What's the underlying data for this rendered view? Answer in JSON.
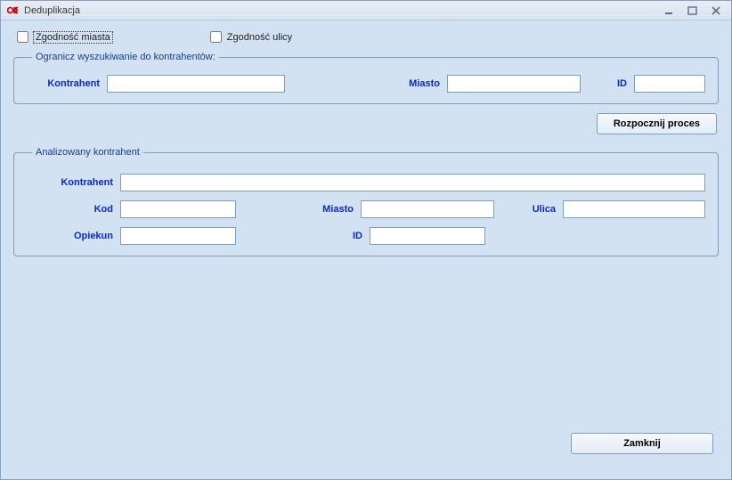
{
  "window": {
    "title": "Deduplikacja"
  },
  "checkboxes": {
    "city_match_label": "Zgodność miasta",
    "street_match_label": "Zgodność ulicy"
  },
  "search_limit": {
    "legend": "Ogranicz wyszukiwanie do kontrahentów:",
    "kontrahent_label": "Kontrahent",
    "kontrahent_value": "",
    "miasto_label": "Miasto",
    "miasto_value": "",
    "id_label": "ID",
    "id_value": ""
  },
  "buttons": {
    "start_process": "Rozpocznij proces",
    "close": "Zamknij"
  },
  "analyzed": {
    "legend": "Analizowany kontrahent",
    "kontrahent_label": "Kontrahent",
    "kontrahent_value": "",
    "kod_label": "Kod",
    "kod_value": "",
    "miasto_label": "Miasto",
    "miasto_value": "",
    "ulica_label": "Ulica",
    "ulica_value": "",
    "opiekun_label": "Opiekun",
    "opiekun_value": "",
    "id_label": "ID",
    "id_value": ""
  }
}
